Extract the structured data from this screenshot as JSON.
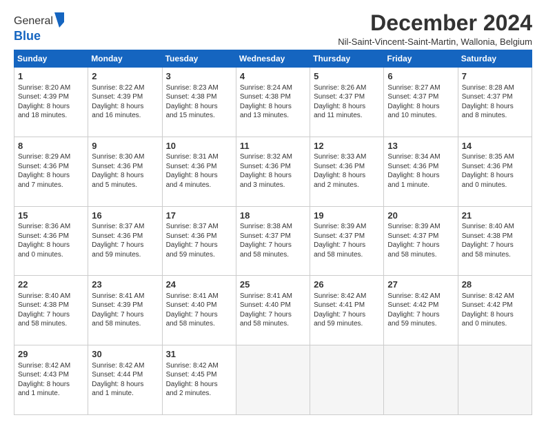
{
  "logo": {
    "line1": "General",
    "line2": "Blue"
  },
  "header": {
    "title": "December 2024",
    "subtitle": "Nil-Saint-Vincent-Saint-Martin, Wallonia, Belgium"
  },
  "weekdays": [
    "Sunday",
    "Monday",
    "Tuesday",
    "Wednesday",
    "Thursday",
    "Friday",
    "Saturday"
  ],
  "weeks": [
    [
      {
        "day": "1",
        "info": "Sunrise: 8:20 AM\nSunset: 4:39 PM\nDaylight: 8 hours\nand 18 minutes."
      },
      {
        "day": "2",
        "info": "Sunrise: 8:22 AM\nSunset: 4:39 PM\nDaylight: 8 hours\nand 16 minutes."
      },
      {
        "day": "3",
        "info": "Sunrise: 8:23 AM\nSunset: 4:38 PM\nDaylight: 8 hours\nand 15 minutes."
      },
      {
        "day": "4",
        "info": "Sunrise: 8:24 AM\nSunset: 4:38 PM\nDaylight: 8 hours\nand 13 minutes."
      },
      {
        "day": "5",
        "info": "Sunrise: 8:26 AM\nSunset: 4:37 PM\nDaylight: 8 hours\nand 11 minutes."
      },
      {
        "day": "6",
        "info": "Sunrise: 8:27 AM\nSunset: 4:37 PM\nDaylight: 8 hours\nand 10 minutes."
      },
      {
        "day": "7",
        "info": "Sunrise: 8:28 AM\nSunset: 4:37 PM\nDaylight: 8 hours\nand 8 minutes."
      }
    ],
    [
      {
        "day": "8",
        "info": "Sunrise: 8:29 AM\nSunset: 4:36 PM\nDaylight: 8 hours\nand 7 minutes."
      },
      {
        "day": "9",
        "info": "Sunrise: 8:30 AM\nSunset: 4:36 PM\nDaylight: 8 hours\nand 5 minutes."
      },
      {
        "day": "10",
        "info": "Sunrise: 8:31 AM\nSunset: 4:36 PM\nDaylight: 8 hours\nand 4 minutes."
      },
      {
        "day": "11",
        "info": "Sunrise: 8:32 AM\nSunset: 4:36 PM\nDaylight: 8 hours\nand 3 minutes."
      },
      {
        "day": "12",
        "info": "Sunrise: 8:33 AM\nSunset: 4:36 PM\nDaylight: 8 hours\nand 2 minutes."
      },
      {
        "day": "13",
        "info": "Sunrise: 8:34 AM\nSunset: 4:36 PM\nDaylight: 8 hours\nand 1 minute."
      },
      {
        "day": "14",
        "info": "Sunrise: 8:35 AM\nSunset: 4:36 PM\nDaylight: 8 hours\nand 0 minutes."
      }
    ],
    [
      {
        "day": "15",
        "info": "Sunrise: 8:36 AM\nSunset: 4:36 PM\nDaylight: 8 hours\nand 0 minutes."
      },
      {
        "day": "16",
        "info": "Sunrise: 8:37 AM\nSunset: 4:36 PM\nDaylight: 7 hours\nand 59 minutes."
      },
      {
        "day": "17",
        "info": "Sunrise: 8:37 AM\nSunset: 4:36 PM\nDaylight: 7 hours\nand 59 minutes."
      },
      {
        "day": "18",
        "info": "Sunrise: 8:38 AM\nSunset: 4:37 PM\nDaylight: 7 hours\nand 58 minutes."
      },
      {
        "day": "19",
        "info": "Sunrise: 8:39 AM\nSunset: 4:37 PM\nDaylight: 7 hours\nand 58 minutes."
      },
      {
        "day": "20",
        "info": "Sunrise: 8:39 AM\nSunset: 4:37 PM\nDaylight: 7 hours\nand 58 minutes."
      },
      {
        "day": "21",
        "info": "Sunrise: 8:40 AM\nSunset: 4:38 PM\nDaylight: 7 hours\nand 58 minutes."
      }
    ],
    [
      {
        "day": "22",
        "info": "Sunrise: 8:40 AM\nSunset: 4:38 PM\nDaylight: 7 hours\nand 58 minutes."
      },
      {
        "day": "23",
        "info": "Sunrise: 8:41 AM\nSunset: 4:39 PM\nDaylight: 7 hours\nand 58 minutes."
      },
      {
        "day": "24",
        "info": "Sunrise: 8:41 AM\nSunset: 4:40 PM\nDaylight: 7 hours\nand 58 minutes."
      },
      {
        "day": "25",
        "info": "Sunrise: 8:41 AM\nSunset: 4:40 PM\nDaylight: 7 hours\nand 58 minutes."
      },
      {
        "day": "26",
        "info": "Sunrise: 8:42 AM\nSunset: 4:41 PM\nDaylight: 7 hours\nand 59 minutes."
      },
      {
        "day": "27",
        "info": "Sunrise: 8:42 AM\nSunset: 4:42 PM\nDaylight: 7 hours\nand 59 minutes."
      },
      {
        "day": "28",
        "info": "Sunrise: 8:42 AM\nSunset: 4:42 PM\nDaylight: 8 hours\nand 0 minutes."
      }
    ],
    [
      {
        "day": "29",
        "info": "Sunrise: 8:42 AM\nSunset: 4:43 PM\nDaylight: 8 hours\nand 1 minute."
      },
      {
        "day": "30",
        "info": "Sunrise: 8:42 AM\nSunset: 4:44 PM\nDaylight: 8 hours\nand 1 minute."
      },
      {
        "day": "31",
        "info": "Sunrise: 8:42 AM\nSunset: 4:45 PM\nDaylight: 8 hours\nand 2 minutes."
      },
      {
        "day": "",
        "info": ""
      },
      {
        "day": "",
        "info": ""
      },
      {
        "day": "",
        "info": ""
      },
      {
        "day": "",
        "info": ""
      }
    ]
  ]
}
